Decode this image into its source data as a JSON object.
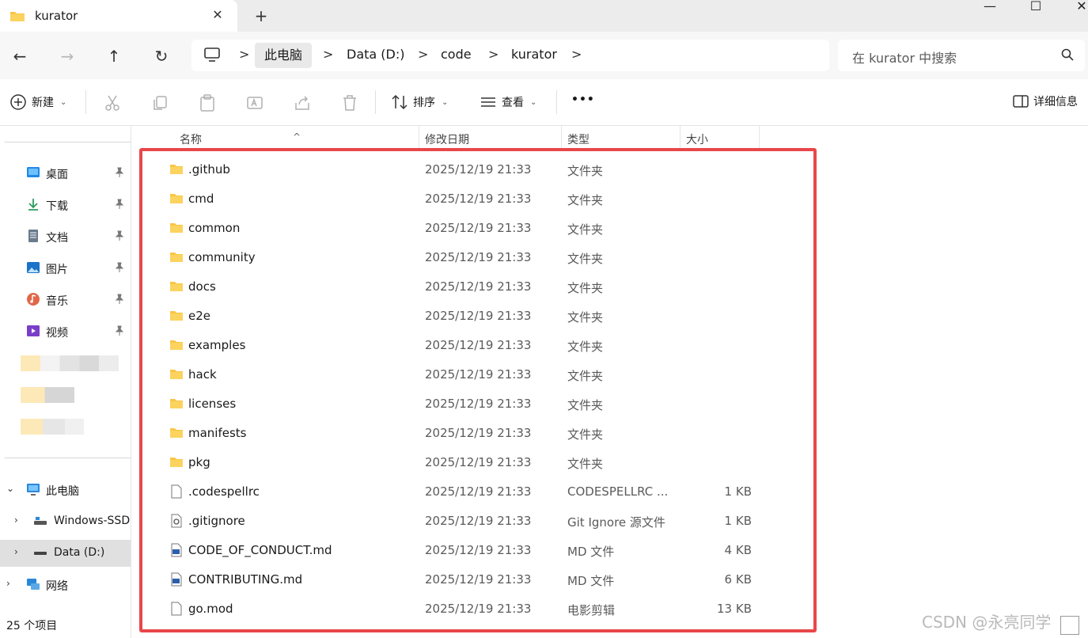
{
  "window": {
    "tab_title": "kurator",
    "close_tab_glyph": "✕",
    "new_tab_glyph": "+",
    "controls": {
      "minimize": "—",
      "maximize": "☐",
      "close": "✕"
    }
  },
  "nav": {
    "back": "←",
    "forward": "→",
    "up": "↑",
    "refresh": "↻"
  },
  "breadcrumb": {
    "items": [
      "此电脑",
      "Data (D:)",
      "code",
      "kurator"
    ],
    "separator": ">"
  },
  "search": {
    "placeholder": "在 kurator 中搜索"
  },
  "commandbar": {
    "new_label": "新建",
    "sort_label": "排序",
    "view_label": "查看",
    "more_label": "•••",
    "details_label": "详细信息"
  },
  "sidebar": {
    "quick_access": [
      {
        "label": "桌面",
        "icon": "desktop-icon",
        "color": "#1e88e5"
      },
      {
        "label": "下载",
        "icon": "download-icon",
        "color": "#2e9b5f"
      },
      {
        "label": "文档",
        "icon": "document-icon",
        "color": "#6b7b8c"
      },
      {
        "label": "图片",
        "icon": "pictures-icon",
        "color": "#1a73c8"
      },
      {
        "label": "音乐",
        "icon": "music-icon",
        "color": "#e0674a"
      },
      {
        "label": "视频",
        "icon": "video-icon",
        "color": "#7a3ec8"
      }
    ],
    "tree": [
      {
        "label": "此电脑",
        "expanded": true
      },
      {
        "label": "Windows-SSD"
      },
      {
        "label": "Data (D:)",
        "selected": true
      },
      {
        "label": "网络"
      }
    ],
    "status": "25 个项目"
  },
  "columns": {
    "name": "名称",
    "date": "修改日期",
    "type": "类型",
    "size": "大小"
  },
  "files": [
    {
      "name": ".github",
      "date": "2025/12/19 21:33",
      "type": "文件夹",
      "size": "",
      "kind": "folder"
    },
    {
      "name": "cmd",
      "date": "2025/12/19 21:33",
      "type": "文件夹",
      "size": "",
      "kind": "folder"
    },
    {
      "name": "common",
      "date": "2025/12/19 21:33",
      "type": "文件夹",
      "size": "",
      "kind": "folder"
    },
    {
      "name": "community",
      "date": "2025/12/19 21:33",
      "type": "文件夹",
      "size": "",
      "kind": "folder"
    },
    {
      "name": "docs",
      "date": "2025/12/19 21:33",
      "type": "文件夹",
      "size": "",
      "kind": "folder"
    },
    {
      "name": "e2e",
      "date": "2025/12/19 21:33",
      "type": "文件夹",
      "size": "",
      "kind": "folder"
    },
    {
      "name": "examples",
      "date": "2025/12/19 21:33",
      "type": "文件夹",
      "size": "",
      "kind": "folder"
    },
    {
      "name": "hack",
      "date": "2025/12/19 21:33",
      "type": "文件夹",
      "size": "",
      "kind": "folder"
    },
    {
      "name": "licenses",
      "date": "2025/12/19 21:33",
      "type": "文件夹",
      "size": "",
      "kind": "folder"
    },
    {
      "name": "manifests",
      "date": "2025/12/19 21:33",
      "type": "文件夹",
      "size": "",
      "kind": "folder"
    },
    {
      "name": "pkg",
      "date": "2025/12/19 21:33",
      "type": "文件夹",
      "size": "",
      "kind": "folder"
    },
    {
      "name": ".codespellrc",
      "date": "2025/12/19 21:33",
      "type": "CODESPELLRC ...",
      "size": "1 KB",
      "kind": "file"
    },
    {
      "name": ".gitignore",
      "date": "2025/12/19 21:33",
      "type": "Git Ignore 源文件",
      "size": "1 KB",
      "kind": "gear"
    },
    {
      "name": "CODE_OF_CONDUCT.md",
      "date": "2025/12/19 21:33",
      "type": "MD 文件",
      "size": "4 KB",
      "kind": "md"
    },
    {
      "name": "CONTRIBUTING.md",
      "date": "2025/12/19 21:33",
      "type": "MD 文件",
      "size": "6 KB",
      "kind": "md"
    },
    {
      "name": "go.mod",
      "date": "2025/12/19 21:33",
      "type": "电影剪辑",
      "size": "13 KB",
      "kind": "file"
    }
  ],
  "highlight_color": "#e8474a",
  "watermark": "CSDN @永亮同学"
}
